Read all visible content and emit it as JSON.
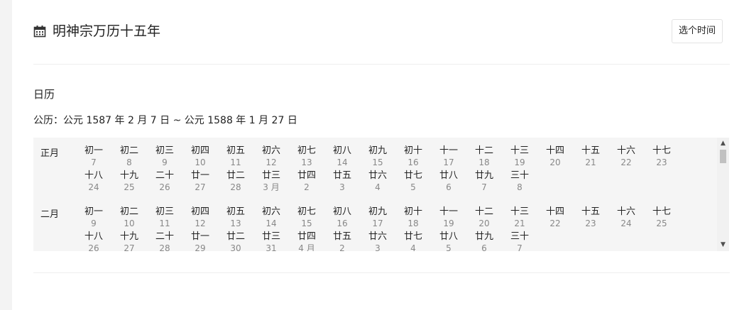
{
  "header": {
    "title": "明神宗万历十五年",
    "pick_button": "选个时间"
  },
  "section": {
    "title": "日历",
    "range": "公历：公元 1587 年 2 月 7 日 ~ 公元 1588 年 1 月 27 日"
  },
  "months": [
    {
      "name": "正月",
      "days": [
        {
          "lunar": "初一",
          "solar": "7"
        },
        {
          "lunar": "初二",
          "solar": "8"
        },
        {
          "lunar": "初三",
          "solar": "9"
        },
        {
          "lunar": "初四",
          "solar": "10"
        },
        {
          "lunar": "初五",
          "solar": "11"
        },
        {
          "lunar": "初六",
          "solar": "12"
        },
        {
          "lunar": "初七",
          "solar": "13"
        },
        {
          "lunar": "初八",
          "solar": "14"
        },
        {
          "lunar": "初九",
          "solar": "15"
        },
        {
          "lunar": "初十",
          "solar": "16"
        },
        {
          "lunar": "十一",
          "solar": "17"
        },
        {
          "lunar": "十二",
          "solar": "18"
        },
        {
          "lunar": "十三",
          "solar": "19"
        },
        {
          "lunar": "十四",
          "solar": "20"
        },
        {
          "lunar": "十五",
          "solar": "21"
        },
        {
          "lunar": "十六",
          "solar": "22"
        },
        {
          "lunar": "十七",
          "solar": "23"
        },
        {
          "lunar": "十八",
          "solar": "24"
        },
        {
          "lunar": "十九",
          "solar": "25"
        },
        {
          "lunar": "二十",
          "solar": "26"
        },
        {
          "lunar": "廿一",
          "solar": "27"
        },
        {
          "lunar": "廿二",
          "solar": "28"
        },
        {
          "lunar": "廿三",
          "solar": "3 月"
        },
        {
          "lunar": "廿四",
          "solar": "2"
        },
        {
          "lunar": "廿五",
          "solar": "3"
        },
        {
          "lunar": "廿六",
          "solar": "4"
        },
        {
          "lunar": "廿七",
          "solar": "5"
        },
        {
          "lunar": "廿八",
          "solar": "6"
        },
        {
          "lunar": "廿九",
          "solar": "7"
        },
        {
          "lunar": "三十",
          "solar": "8"
        }
      ]
    },
    {
      "name": "二月",
      "days": [
        {
          "lunar": "初一",
          "solar": "9"
        },
        {
          "lunar": "初二",
          "solar": "10"
        },
        {
          "lunar": "初三",
          "solar": "11"
        },
        {
          "lunar": "初四",
          "solar": "12"
        },
        {
          "lunar": "初五",
          "solar": "13"
        },
        {
          "lunar": "初六",
          "solar": "14"
        },
        {
          "lunar": "初七",
          "solar": "15"
        },
        {
          "lunar": "初八",
          "solar": "16"
        },
        {
          "lunar": "初九",
          "solar": "17"
        },
        {
          "lunar": "初十",
          "solar": "18"
        },
        {
          "lunar": "十一",
          "solar": "19"
        },
        {
          "lunar": "十二",
          "solar": "20"
        },
        {
          "lunar": "十三",
          "solar": "21"
        },
        {
          "lunar": "十四",
          "solar": "22"
        },
        {
          "lunar": "十五",
          "solar": "23"
        },
        {
          "lunar": "十六",
          "solar": "24"
        },
        {
          "lunar": "十七",
          "solar": "25"
        },
        {
          "lunar": "十八",
          "solar": "26"
        },
        {
          "lunar": "十九",
          "solar": "27"
        },
        {
          "lunar": "二十",
          "solar": "28"
        },
        {
          "lunar": "廿一",
          "solar": "29"
        },
        {
          "lunar": "廿二",
          "solar": "30"
        },
        {
          "lunar": "廿三",
          "solar": "31"
        },
        {
          "lunar": "廿四",
          "solar": "4 月"
        },
        {
          "lunar": "廿五",
          "solar": "2"
        },
        {
          "lunar": "廿六",
          "solar": "3"
        },
        {
          "lunar": "廿七",
          "solar": "4"
        },
        {
          "lunar": "廿八",
          "solar": "5"
        },
        {
          "lunar": "廿九",
          "solar": "6"
        },
        {
          "lunar": "三十",
          "solar": "7"
        }
      ]
    }
  ],
  "scrollbar": {
    "up_icon": "triangle-up",
    "down_icon": "triangle-down"
  },
  "colors": {
    "panel_bg": "#f5f5f5",
    "solar_text": "#888888",
    "text": "#222222"
  }
}
